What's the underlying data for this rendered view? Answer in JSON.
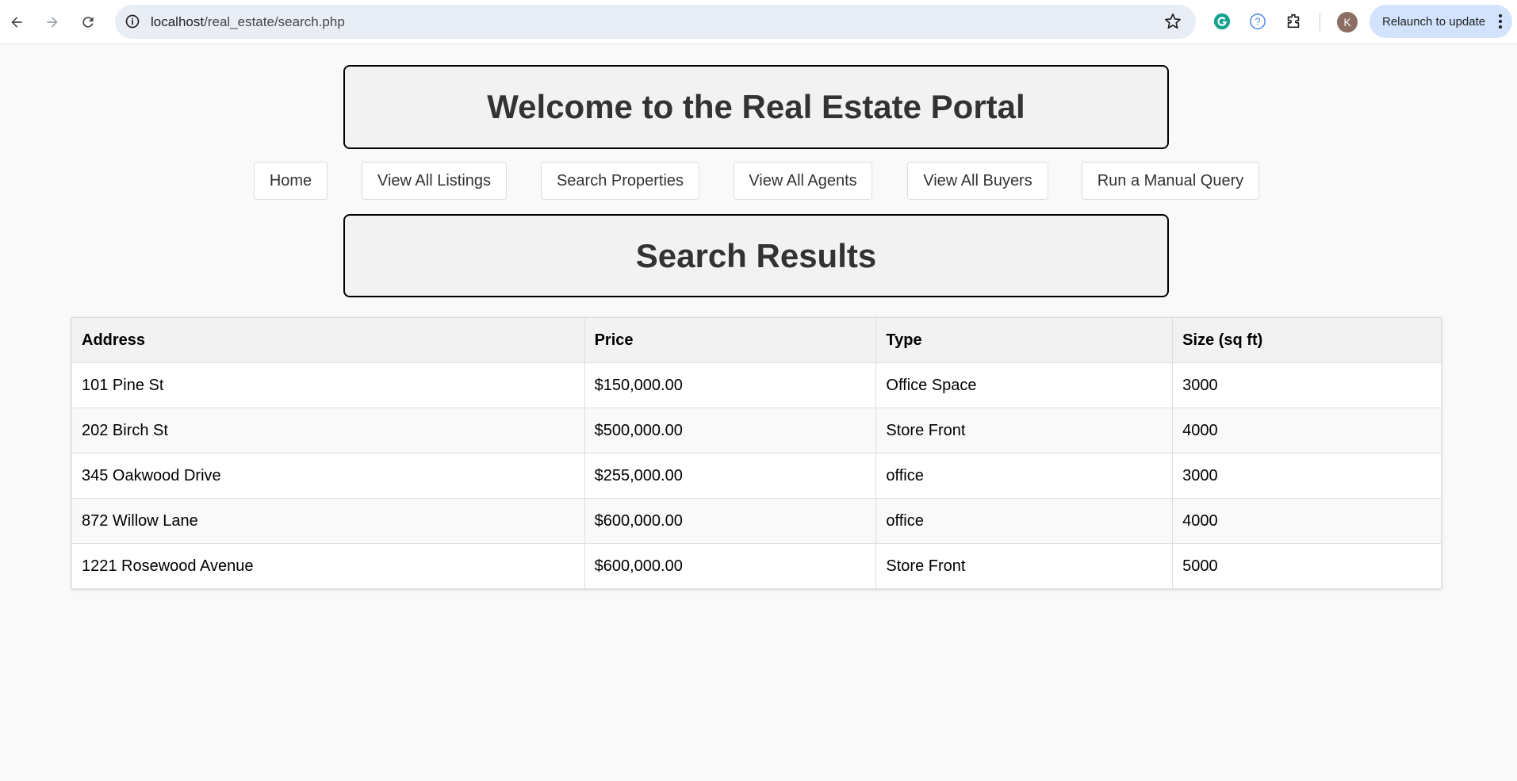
{
  "browser": {
    "url_host": "localhost",
    "url_path": "/real_estate/search.php",
    "relaunch_label": "Relaunch to update",
    "avatar_letter": "K"
  },
  "header": {
    "title": "Welcome to the Real Estate Portal"
  },
  "nav": {
    "items": [
      {
        "label": "Home"
      },
      {
        "label": "View All Listings"
      },
      {
        "label": "Search Properties"
      },
      {
        "label": "View All Agents"
      },
      {
        "label": "View All Buyers"
      },
      {
        "label": "Run a Manual Query"
      }
    ]
  },
  "results": {
    "title": "Search Results",
    "columns": [
      "Address",
      "Price",
      "Type",
      "Size (sq ft)"
    ],
    "rows": [
      [
        "101 Pine St",
        "$150,000.00",
        "Office Space",
        "3000"
      ],
      [
        "202 Birch St",
        "$500,000.00",
        "Store Front",
        "4000"
      ],
      [
        "345 Oakwood Drive",
        "$255,000.00",
        "office",
        "3000"
      ],
      [
        "872 Willow Lane",
        "$600,000.00",
        "office",
        "4000"
      ],
      [
        "1221 Rosewood Avenue",
        "$600,000.00",
        "Store Front",
        "5000"
      ]
    ]
  }
}
